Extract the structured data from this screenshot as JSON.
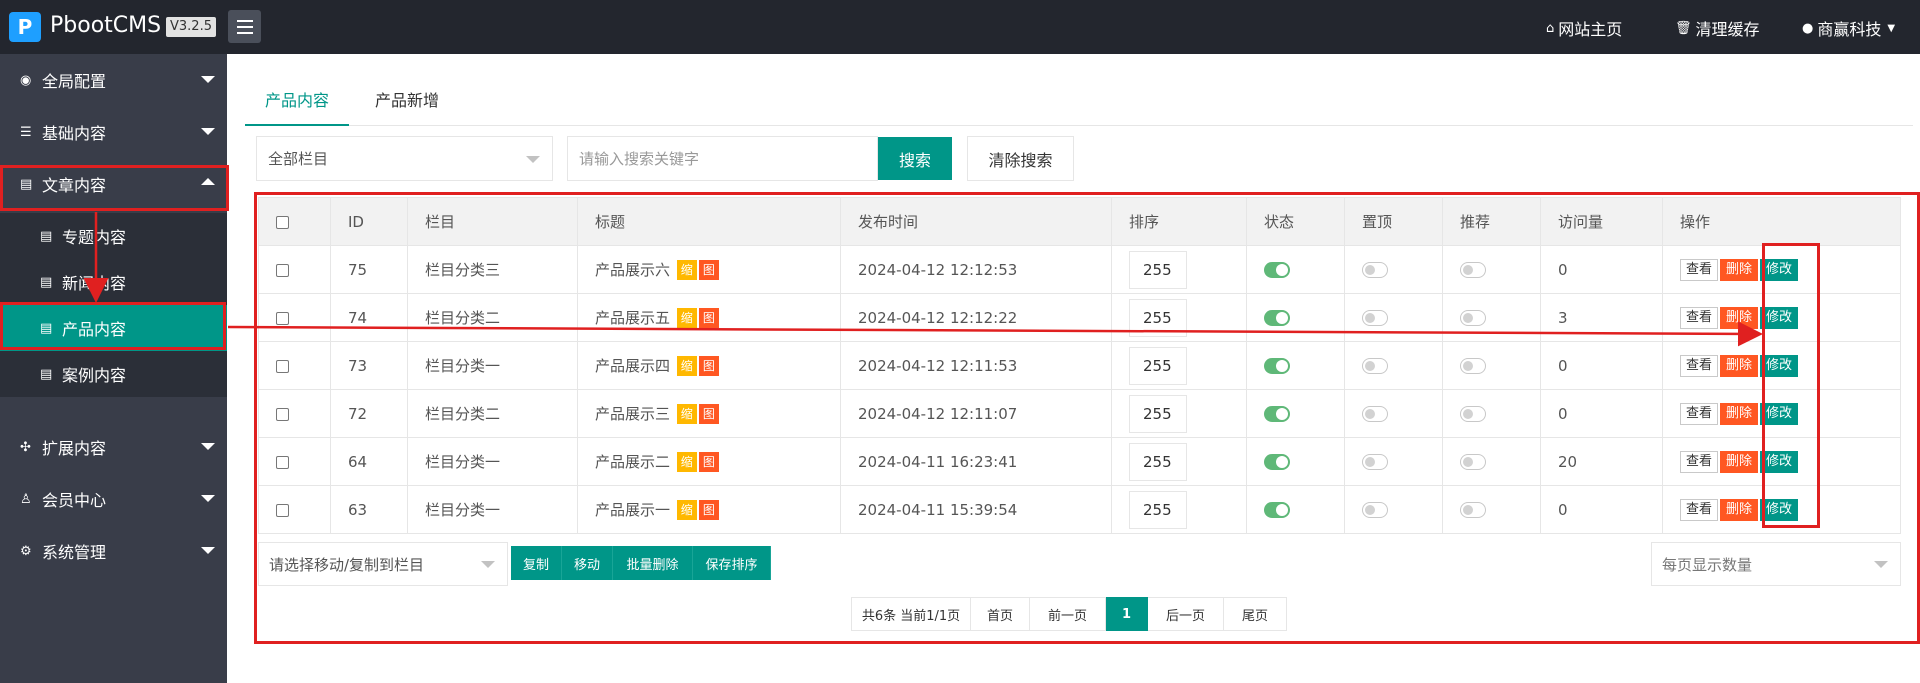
{
  "header": {
    "brand": "PbootCMS",
    "version": "V3.2.5",
    "links": [
      {
        "label": "网站主页",
        "icon": "home-icon"
      },
      {
        "label": "清理缓存",
        "icon": "trash-icon"
      },
      {
        "label": "商赢科技",
        "icon": "user-icon"
      }
    ]
  },
  "sidebar": {
    "items": [
      {
        "label": "全局配置",
        "icon": "globe-icon"
      },
      {
        "label": "基础内容",
        "icon": "sliders-icon"
      },
      {
        "label": "文章内容",
        "icon": "document-icon"
      },
      {
        "label": "扩展内容",
        "icon": "expand-icon"
      },
      {
        "label": "会员中心",
        "icon": "user-icon"
      },
      {
        "label": "系统管理",
        "icon": "gear-icon"
      }
    ],
    "subitems": [
      {
        "label": "专题内容"
      },
      {
        "label": "新闻内容"
      },
      {
        "label": "产品内容"
      },
      {
        "label": "案例内容"
      }
    ]
  },
  "tabs": [
    {
      "label": "产品内容"
    },
    {
      "label": "产品新增"
    }
  ],
  "search": {
    "category": "全部栏目",
    "placeholder": "请输入搜索关键字",
    "search_btn": "搜索",
    "clear_btn": "清除搜索"
  },
  "table": {
    "headers": [
      "ID",
      "栏目",
      "标题",
      "发布时间",
      "排序",
      "状态",
      "置顶",
      "推荐",
      "访问量",
      "操作"
    ],
    "rows": [
      {
        "id": "75",
        "cat": "栏目分类三",
        "title": "产品展示六",
        "time": "2024-04-12 12:12:53",
        "sort": "255",
        "status": true,
        "top": false,
        "rec": false,
        "visits": "0"
      },
      {
        "id": "74",
        "cat": "栏目分类二",
        "title": "产品展示五",
        "time": "2024-04-12 12:12:22",
        "sort": "255",
        "status": true,
        "top": false,
        "rec": false,
        "visits": "3"
      },
      {
        "id": "73",
        "cat": "栏目分类一",
        "title": "产品展示四",
        "time": "2024-04-12 12:11:53",
        "sort": "255",
        "status": true,
        "top": false,
        "rec": false,
        "visits": "0"
      },
      {
        "id": "72",
        "cat": "栏目分类二",
        "title": "产品展示三",
        "time": "2024-04-12 12:11:07",
        "sort": "255",
        "status": true,
        "top": false,
        "rec": false,
        "visits": "0"
      },
      {
        "id": "64",
        "cat": "栏目分类一",
        "title": "产品展示二",
        "time": "2024-04-11 16:23:41",
        "sort": "255",
        "status": true,
        "top": false,
        "rec": false,
        "visits": "20"
      },
      {
        "id": "63",
        "cat": "栏目分类一",
        "title": "产品展示一",
        "time": "2024-04-11 15:39:54",
        "sort": "255",
        "status": true,
        "top": false,
        "rec": false,
        "visits": "0"
      }
    ],
    "tag_thumb": "缩",
    "tag_image": "图",
    "op_view": "查看",
    "op_delete": "删除",
    "op_edit": "修改"
  },
  "bottom": {
    "move_placeholder": "请选择移动/复制到栏目",
    "copy_btn": "复制",
    "move_btn": "移动",
    "batch_delete_btn": "批量删除",
    "save_sort_btn": "保存排序",
    "per_page_placeholder": "每页显示数量"
  },
  "pager": {
    "summary": "共6条 当前1/1页",
    "first": "首页",
    "prev": "前一页",
    "current": "1",
    "next": "后一页",
    "last": "尾页"
  },
  "colors": {
    "accent": "#009688",
    "annotation": "#e02020"
  }
}
